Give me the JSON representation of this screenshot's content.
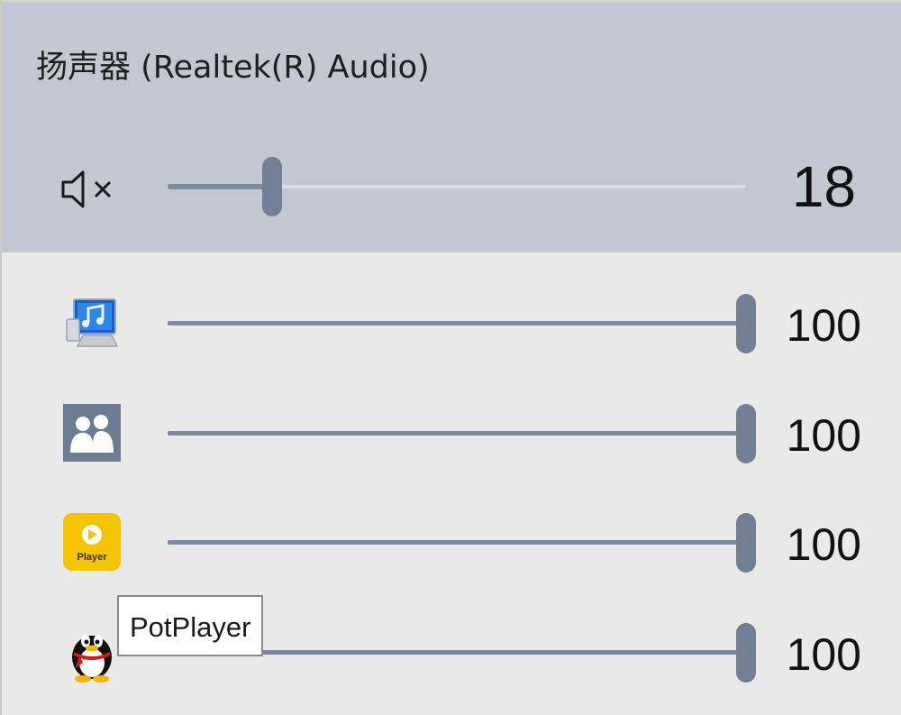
{
  "device": {
    "title": "扬声器 (Realtek(R) Audio)",
    "volume_label": "18",
    "volume": 18,
    "muted_icon": "speaker-muted-icon"
  },
  "apps": [
    {
      "icon": "system-sounds-icon",
      "volume_label": "100",
      "volume": 100
    },
    {
      "icon": "people-icon",
      "volume_label": "100",
      "volume": 100
    },
    {
      "icon": "player-icon",
      "icon_text": "Player",
      "volume_label": "100",
      "volume": 100
    },
    {
      "icon": "qq-penguin-icon",
      "volume_label": "100",
      "volume": 100
    }
  ],
  "tooltip": {
    "text": "PotPlayer"
  },
  "colors": {
    "header_bg": "#c2c7d1",
    "body_bg": "#e9e9e9",
    "slider_thumb": "#727f94",
    "slider_fill": "#7c8aa0"
  }
}
